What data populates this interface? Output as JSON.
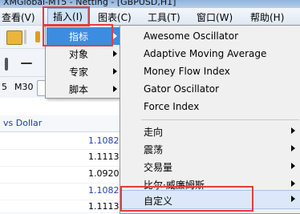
{
  "window": {
    "title": "XMGlobal-MT5 - Netting - [GBPUSD,H1]"
  },
  "menubar": {
    "items": [
      {
        "label": "查看(V)"
      },
      {
        "label": "插入(I)"
      },
      {
        "label": "图表(C)"
      },
      {
        "label": "工具(T)"
      },
      {
        "label": "窗口(W)"
      },
      {
        "label": "帮助(H)"
      }
    ]
  },
  "toolbar": {
    "timeframe_partial": "5",
    "timeframe_m30": "M30"
  },
  "panel": {
    "header_partial": "vs Dollar",
    "prices": [
      "1.1082",
      "1.1113",
      "1.0920",
      "1.1082",
      "1.1113"
    ]
  },
  "insert_menu": {
    "items": [
      {
        "label": "指标",
        "highlighted": true
      },
      {
        "label": "对象"
      },
      {
        "label": "专家"
      },
      {
        "label": "脚本"
      }
    ]
  },
  "indicators_menu": {
    "items": [
      {
        "label": "Awesome Oscillator"
      },
      {
        "label": "Adaptive Moving Average"
      },
      {
        "label": "Money Flow Index"
      },
      {
        "label": "Gator Oscillator"
      },
      {
        "label": "Force Index"
      }
    ],
    "categories": [
      {
        "label": "走向"
      },
      {
        "label": "震荡"
      },
      {
        "label": "交易量"
      },
      {
        "label": "比尔·威廉姆斯"
      },
      {
        "label": "自定义",
        "highlighted": true
      }
    ]
  },
  "colors": {
    "menu_highlight": "#3c8de0",
    "annotation_red": "#e53c3c",
    "price_blue": "#1f3fae"
  }
}
